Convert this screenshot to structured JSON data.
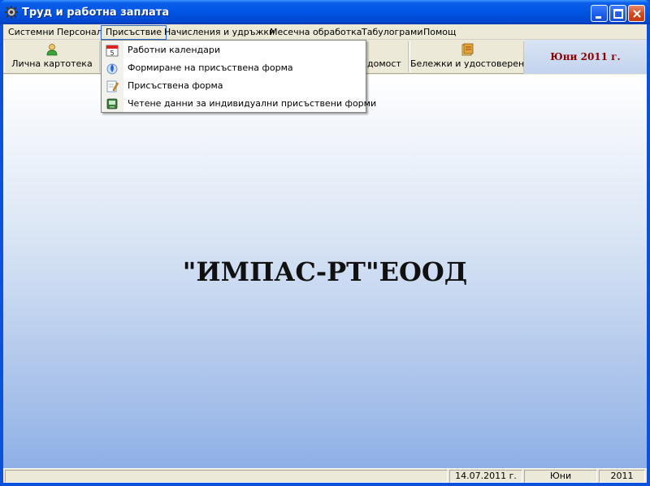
{
  "window": {
    "title": "Труд и работна заплата",
    "accent": "#0055e5"
  },
  "menubar": {
    "items": [
      {
        "label": "Системни"
      },
      {
        "label": "Персонал"
      },
      {
        "label": "Присъствие"
      },
      {
        "label": "Начисления и удръжки"
      },
      {
        "label": "Месечна обработка"
      },
      {
        "label": "Табулограми"
      },
      {
        "label": "Помощ"
      }
    ]
  },
  "toolbar": {
    "personal_file": {
      "label": "Лична картотека",
      "icon": "person-icon"
    },
    "payroll_partial": {
      "label": "домост"
    },
    "notes_certificates": {
      "label": "Бележки и удостоверения",
      "icon": "notebook-icon"
    },
    "period": "Юни 2011 г.",
    "period_color": "#8b0000"
  },
  "dropdown": {
    "items": [
      {
        "label": "Работни календари",
        "icon": "calendar-icon"
      },
      {
        "label": "Формиране на присъствена форма",
        "icon": "drop-icon"
      },
      {
        "label": "Присъствена форма",
        "icon": "form-edit-icon"
      },
      {
        "label": "Четене данни за индивидуални присъствени форми",
        "icon": "reader-device-icon"
      }
    ]
  },
  "main": {
    "company": "\"ИМПАС-РТ\"ЕООД"
  },
  "statusbar": {
    "date": "14.07.2011 г.",
    "month": "Юни",
    "year": "2011"
  }
}
